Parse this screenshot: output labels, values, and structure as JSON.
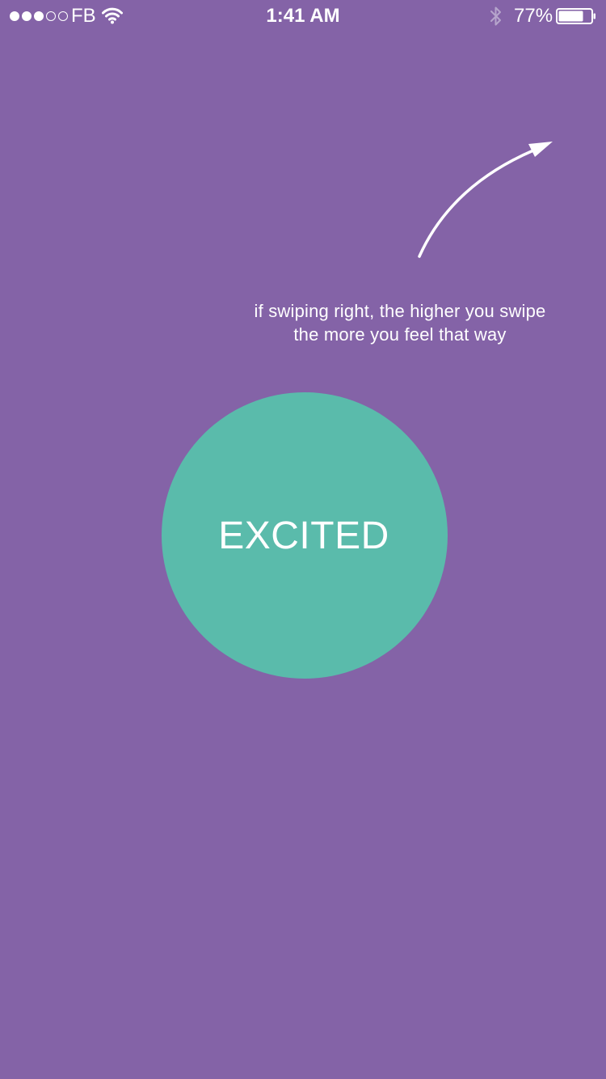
{
  "status_bar": {
    "signal_dots": [
      true,
      true,
      true,
      false,
      false
    ],
    "carrier": "FB",
    "time": "1:41 AM",
    "battery_percent": "77%",
    "battery_level": 0.77,
    "icons": [
      "wifi-icon",
      "bluetooth-icon",
      "battery-icon"
    ]
  },
  "main": {
    "hint_line_1": "if swiping right, the higher you swipe",
    "hint_line_2": "the more you feel that way",
    "mood_label": "EXCITED",
    "arrow_icon": "curved-arrow-up-right"
  },
  "colors": {
    "background": "#8463a7",
    "circle": "#5abbab",
    "text": "#ffffff"
  }
}
